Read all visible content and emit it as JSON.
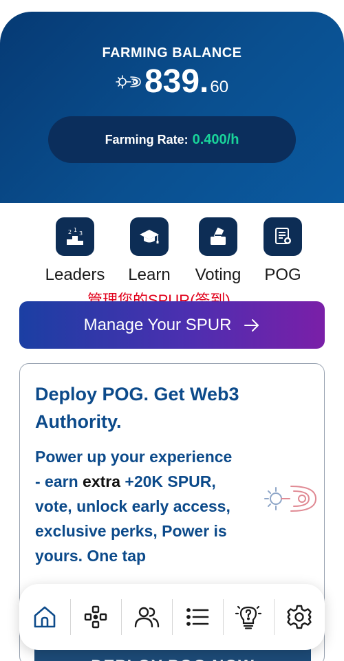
{
  "balance_card": {
    "title": "FARMING BALANCE",
    "amount_int": "839.",
    "amount_dec": "60",
    "rate_label": "Farming Rate:",
    "rate_value": "0.400/h",
    "icon": "spur-logo-icon"
  },
  "quick_nav": {
    "items": [
      {
        "label": "Leaders",
        "icon": "podium-icon"
      },
      {
        "label": "Learn",
        "icon": "graduation-cap-icon"
      },
      {
        "label": "Voting",
        "icon": "ballot-box-icon"
      },
      {
        "label": "POG",
        "icon": "certificate-icon"
      }
    ]
  },
  "annotation_text": "管理您的SPUR(签到)",
  "manage_button": {
    "label": "Manage Your SPUR",
    "icon": "arrow-right-icon"
  },
  "promo_card": {
    "title": "Deploy POG. Get Web3 Authority.",
    "body_part1": "Power up your experience - earn",
    "body_part2": " extra ",
    "body_part3": "+20K SPUR, vote, unlock early access, exclusive perks, Power is yours. One tap",
    "button_label": "DEPLOY POG NOW",
    "illustration_icon": "spur-logo-icon"
  },
  "bottom_nav": {
    "items": [
      {
        "icon": "home-icon"
      },
      {
        "icon": "gamepad-icon"
      },
      {
        "icon": "users-icon"
      },
      {
        "icon": "list-icon"
      },
      {
        "icon": "lightbulb-question-icon"
      },
      {
        "icon": "gear-icon"
      }
    ]
  },
  "colors": {
    "hero_gradient_start": "#063a74",
    "hero_gradient_end": "#0b5aa0",
    "rate_green": "#19d49a",
    "brand_blue": "#0c4a8a",
    "button_gradient_start": "#1b3fa3",
    "button_gradient_end": "#7a1fa8",
    "annotation_red": "#e0001b"
  }
}
